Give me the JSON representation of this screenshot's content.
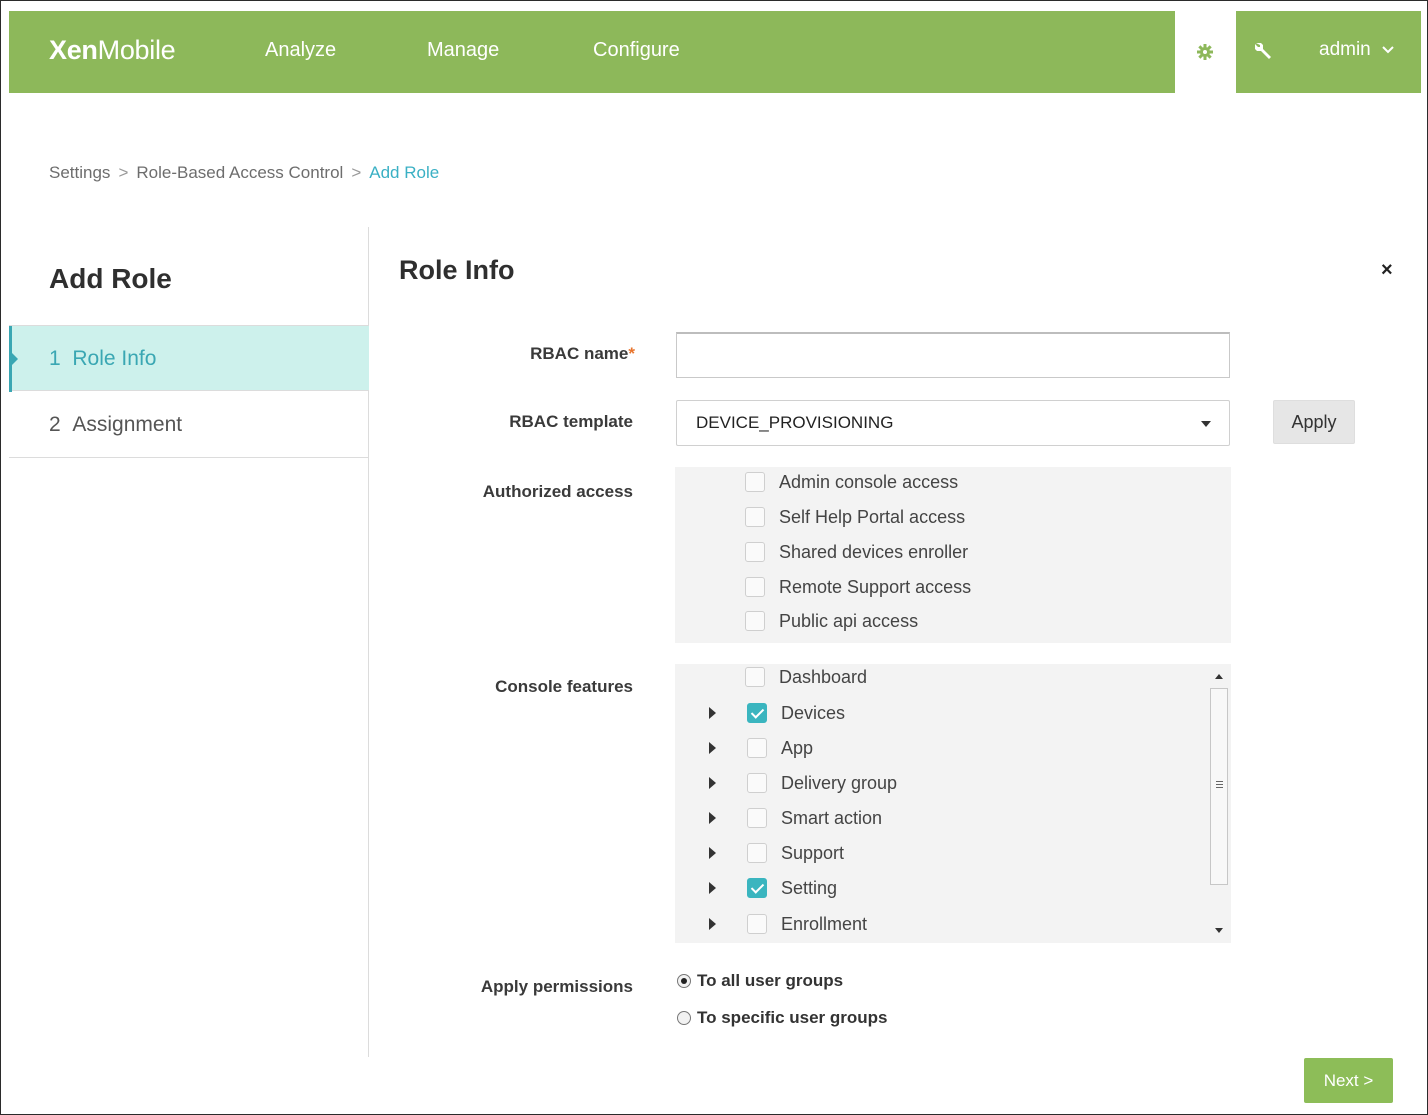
{
  "header": {
    "logo_bold": "Xen",
    "logo_light": "Mobile",
    "nav": [
      "Analyze",
      "Manage",
      "Configure"
    ],
    "user": "admin",
    "accent_color": "#8db85a"
  },
  "breadcrumb": {
    "items": [
      "Settings",
      "Role-Based Access Control"
    ],
    "current": "Add Role",
    "separator": ">"
  },
  "wizard": {
    "title": "Add Role",
    "steps": [
      {
        "number": "1",
        "label": "Role Info",
        "active": true
      },
      {
        "number": "2",
        "label": "Assignment",
        "active": false
      }
    ]
  },
  "main": {
    "title": "Role Info",
    "close_label": "×",
    "rbac_name": {
      "label": "RBAC name",
      "required_mark": "*",
      "value": ""
    },
    "rbac_template": {
      "label": "RBAC template",
      "selected": "DEVICE_PROVISIONING",
      "apply_label": "Apply"
    },
    "authorized_access": {
      "label": "Authorized access",
      "items": [
        {
          "label": "Admin console access",
          "checked": false
        },
        {
          "label": "Self Help Portal access",
          "checked": false
        },
        {
          "label": "Shared devices enroller",
          "checked": false
        },
        {
          "label": "Remote Support access",
          "checked": false
        },
        {
          "label": "Public api access",
          "checked": false
        }
      ]
    },
    "console_features": {
      "label": "Console features",
      "items": [
        {
          "label": "Dashboard",
          "checked": false,
          "expandable": false
        },
        {
          "label": "Devices",
          "checked": true,
          "expandable": true
        },
        {
          "label": "App",
          "checked": false,
          "expandable": true
        },
        {
          "label": "Delivery group",
          "checked": false,
          "expandable": true
        },
        {
          "label": "Smart action",
          "checked": false,
          "expandable": true
        },
        {
          "label": "Support",
          "checked": false,
          "expandable": true
        },
        {
          "label": "Setting",
          "checked": true,
          "expandable": true
        },
        {
          "label": "Enrollment",
          "checked": false,
          "expandable": true
        }
      ]
    },
    "apply_permissions": {
      "label": "Apply permissions",
      "options": [
        {
          "label": "To all user groups",
          "selected": true
        },
        {
          "label": "To specific user groups",
          "selected": false
        }
      ]
    },
    "next_label": "Next >"
  }
}
